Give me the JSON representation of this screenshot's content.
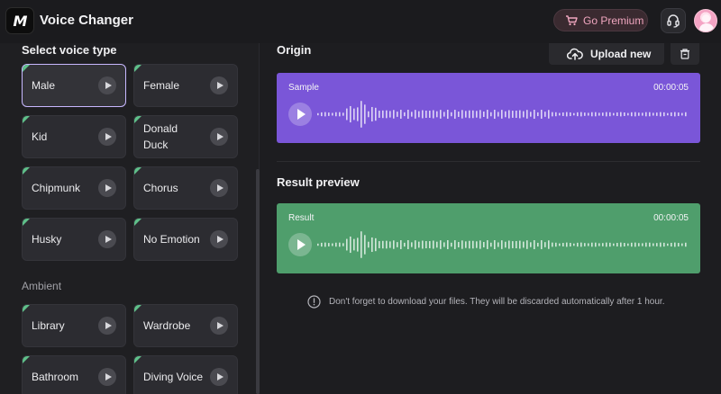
{
  "header": {
    "logo_text": "M",
    "app_title": "Voice Changer",
    "premium_label": "Go Premium"
  },
  "sidebar": {
    "title": "Select voice type",
    "voices": [
      {
        "label": "Male",
        "selected": true
      },
      {
        "label": "Female",
        "selected": false
      },
      {
        "label": "Kid",
        "selected": false
      },
      {
        "label": "Donald Duck",
        "selected": false
      },
      {
        "label": "Chipmunk",
        "selected": false
      },
      {
        "label": "Chorus",
        "selected": false
      },
      {
        "label": "Husky",
        "selected": false
      },
      {
        "label": "No Emotion",
        "selected": false
      }
    ],
    "ambient_label": "Ambient",
    "ambient": [
      {
        "label": "Library"
      },
      {
        "label": "Wardrobe"
      },
      {
        "label": "Bathroom"
      },
      {
        "label": "Diving Voice"
      }
    ]
  },
  "main": {
    "origin_title": "Origin",
    "upload_label": "Upload new",
    "sample": {
      "name": "Sample",
      "time": "00:00:05",
      "color": "#7a56d8"
    },
    "result_title": "Result preview",
    "result": {
      "name": "Result",
      "time": "00:00:05",
      "color": "#4f9e6c"
    },
    "notice": "Don't forget to download your files. They will be discarded automatically after 1 hour."
  },
  "colors": {
    "accent_premium": "#f0a6bf",
    "tag_green": "#5fc08a",
    "selected_border": "#c8b8ff"
  }
}
